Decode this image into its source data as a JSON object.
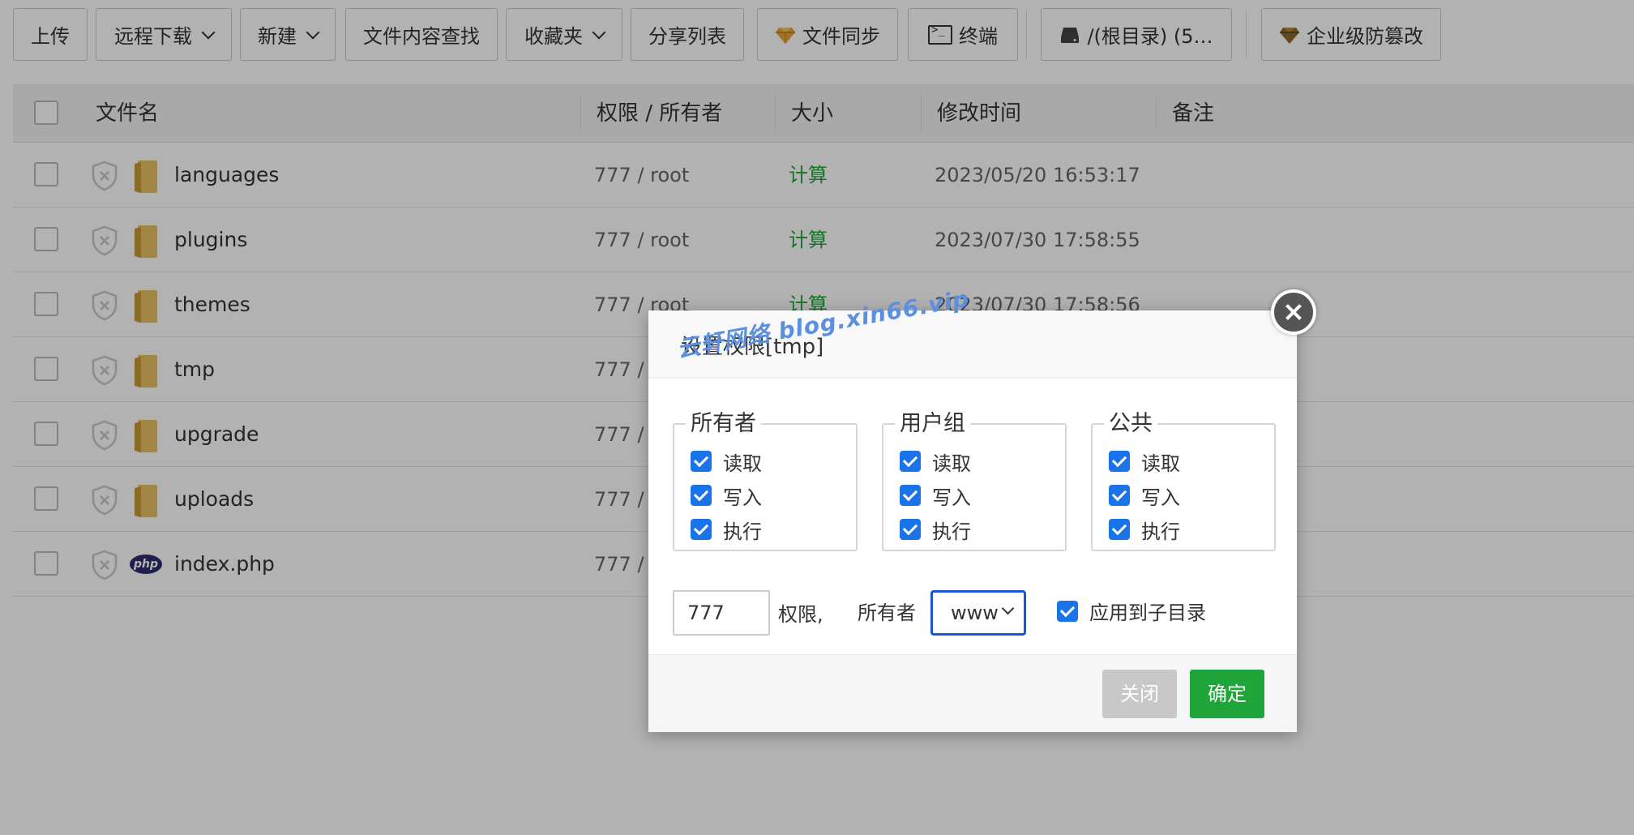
{
  "toolbar": {
    "upload": "上传",
    "remote_download": "远程下载",
    "new": "新建",
    "content_search": "文件内容查找",
    "favorites": "收藏夹",
    "share_list": "分享列表",
    "file_sync": "文件同步",
    "terminal": "终端",
    "disk": "/(根目录) (5…",
    "tamper": "企业级防篡改"
  },
  "table": {
    "headers": {
      "name": "文件名",
      "perm": "权限 / 所有者",
      "size": "大小",
      "mtime": "修改时间",
      "note": "备注"
    },
    "rows": [
      {
        "name": "languages",
        "perm": "777 / root",
        "size": "计算",
        "mtime": "2023/05/20 16:53:17",
        "type": "folder"
      },
      {
        "name": "plugins",
        "perm": "777 / root",
        "size": "计算",
        "mtime": "2023/07/30 17:58:55",
        "type": "folder"
      },
      {
        "name": "themes",
        "perm": "777 / root",
        "size": "计算",
        "mtime": "2023/07/30 17:58:56",
        "type": "folder"
      },
      {
        "name": "tmp",
        "perm": "777 / r",
        "size": "",
        "mtime": "",
        "type": "folder"
      },
      {
        "name": "upgrade",
        "perm": "777 / r",
        "size": "",
        "mtime": "",
        "type": "folder"
      },
      {
        "name": "uploads",
        "perm": "777 / r",
        "size": "",
        "mtime": "",
        "type": "folder"
      },
      {
        "name": "index.php",
        "perm": "777 / r",
        "size": "",
        "mtime": "",
        "type": "php"
      }
    ]
  },
  "modal": {
    "title": "设置权限[tmp]",
    "watermark": "云轩网络  blog.xin66.vip",
    "groups": [
      {
        "legend": "所有者",
        "read": "读取",
        "write": "写入",
        "exec": "执行"
      },
      {
        "legend": "用户组",
        "read": "读取",
        "write": "写入",
        "exec": "执行"
      },
      {
        "legend": "公共",
        "read": "读取",
        "write": "写入",
        "exec": "执行"
      }
    ],
    "perm_value": "777",
    "perm_label": "权限,",
    "owner_label": "所有者",
    "owner_value": "www",
    "apply_sub": "应用到子目录",
    "close_btn": "关闭",
    "ok_btn": "确定"
  },
  "colors": {
    "accent_green": "#20a53a",
    "checkbox_blue": "#1a73e8",
    "folder_yellow": "#e8c060"
  },
  "php_badge": "php"
}
